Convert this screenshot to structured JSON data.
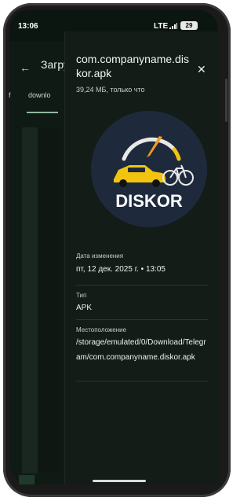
{
  "status_bar": {
    "time": "13:06",
    "network": "LTE",
    "battery": "29"
  },
  "background_app": {
    "title": "Загрузки",
    "tab_partial": "f",
    "tab_active": "downlo"
  },
  "file_info": {
    "name": "com.companyname.diskor.apk",
    "meta": "39,24 МБ, только что",
    "app_logo_text": "DISKOR",
    "fields": [
      {
        "label": "Дата изменения",
        "value": "пт, 12 дек. 2025 г. • 13:05"
      },
      {
        "label": "Тип",
        "value": "APK"
      },
      {
        "label": "Местоположение",
        "value": "/storage/emulated/0/Download/Telegram/com.companyname.diskor.apk"
      }
    ]
  },
  "colors": {
    "sheet_bg": "#131c17",
    "logo_bg": "#1e2a3c",
    "car_yellow": "#f2c40f",
    "needle_orange": "#f39b1f"
  }
}
